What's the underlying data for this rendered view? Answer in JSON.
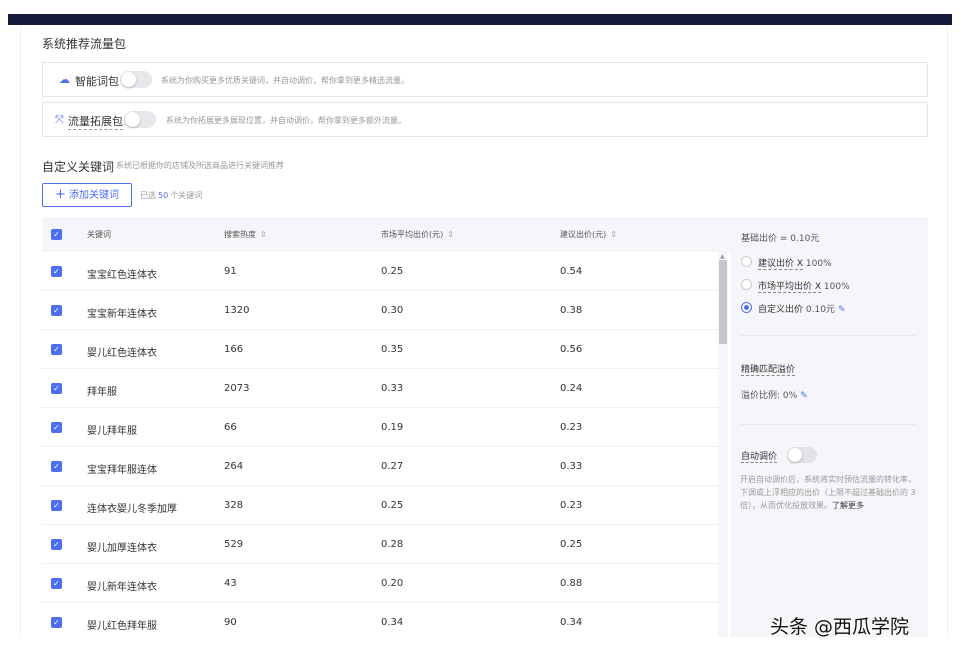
{
  "section_title": "系统推荐流量包",
  "packages": [
    {
      "icon": "cloud-icon",
      "label": "智能词包",
      "desc": "系统为你购买更多优质关键词，并自动调价，帮你拿到更多精选流量。"
    },
    {
      "icon": "expand-icon",
      "label": "流量拓展包",
      "desc": "系统为你拓展更多展现位置，并自动调价，帮你拿到更多额外流量。"
    }
  ],
  "custom": {
    "title": "自定义关键词",
    "subtitle": "系统已根据你的店铺及所选商品进行关键词推荐",
    "add_button": "添加关键词",
    "selected_prefix": "已选",
    "selected_count": "50",
    "selected_suffix": "个关键词"
  },
  "table": {
    "headers": [
      "关键词",
      "搜索热度",
      "市场平均出价(元)",
      "建议出价(元)"
    ],
    "rows": [
      {
        "keyword": "宝宝红色连体衣",
        "heat": "91",
        "avg": "0.25",
        "suggest": "0.54"
      },
      {
        "keyword": "宝宝新年连体衣",
        "heat": "1320",
        "avg": "0.30",
        "suggest": "0.38"
      },
      {
        "keyword": "婴儿红色连体衣",
        "heat": "166",
        "avg": "0.35",
        "suggest": "0.56"
      },
      {
        "keyword": "拜年服",
        "heat": "2073",
        "avg": "0.33",
        "suggest": "0.24"
      },
      {
        "keyword": "婴儿拜年服",
        "heat": "66",
        "avg": "0.19",
        "suggest": "0.23"
      },
      {
        "keyword": "宝宝拜年服连体",
        "heat": "264",
        "avg": "0.27",
        "suggest": "0.33"
      },
      {
        "keyword": "连体衣婴儿冬季加厚",
        "heat": "328",
        "avg": "0.25",
        "suggest": "0.23"
      },
      {
        "keyword": "婴儿加厚连体衣",
        "heat": "529",
        "avg": "0.28",
        "suggest": "0.25"
      },
      {
        "keyword": "婴儿新年连体衣",
        "heat": "43",
        "avg": "0.20",
        "suggest": "0.88"
      },
      {
        "keyword": "婴儿红色拜年服",
        "heat": "90",
        "avg": "0.34",
        "suggest": "0.34"
      }
    ]
  },
  "panel": {
    "base_bid": "基础出价 = 0.10元",
    "options": [
      {
        "label": "建议出价 X",
        "value": "100%",
        "selected": false
      },
      {
        "label": "市场平均出价 X",
        "value": "100%",
        "selected": true
      },
      {
        "label": "自定义出价",
        "value": "0.10元",
        "selected": true
      }
    ],
    "exact_match_title": "精确匹配溢价",
    "premium_ratio": "溢价比例: 0%",
    "auto_title": "自动调价",
    "auto_desc": "开启自动调价后，系统将实时预估流量的转化率，下调或上浮相应的出价（上限不超过基础出价的 3 倍），从而优化投放效果。",
    "auto_more": "了解更多"
  },
  "watermark": "头条 @西瓜学院",
  "colors": {
    "accent": "#4e6ef2",
    "topbar": "#15193b"
  }
}
